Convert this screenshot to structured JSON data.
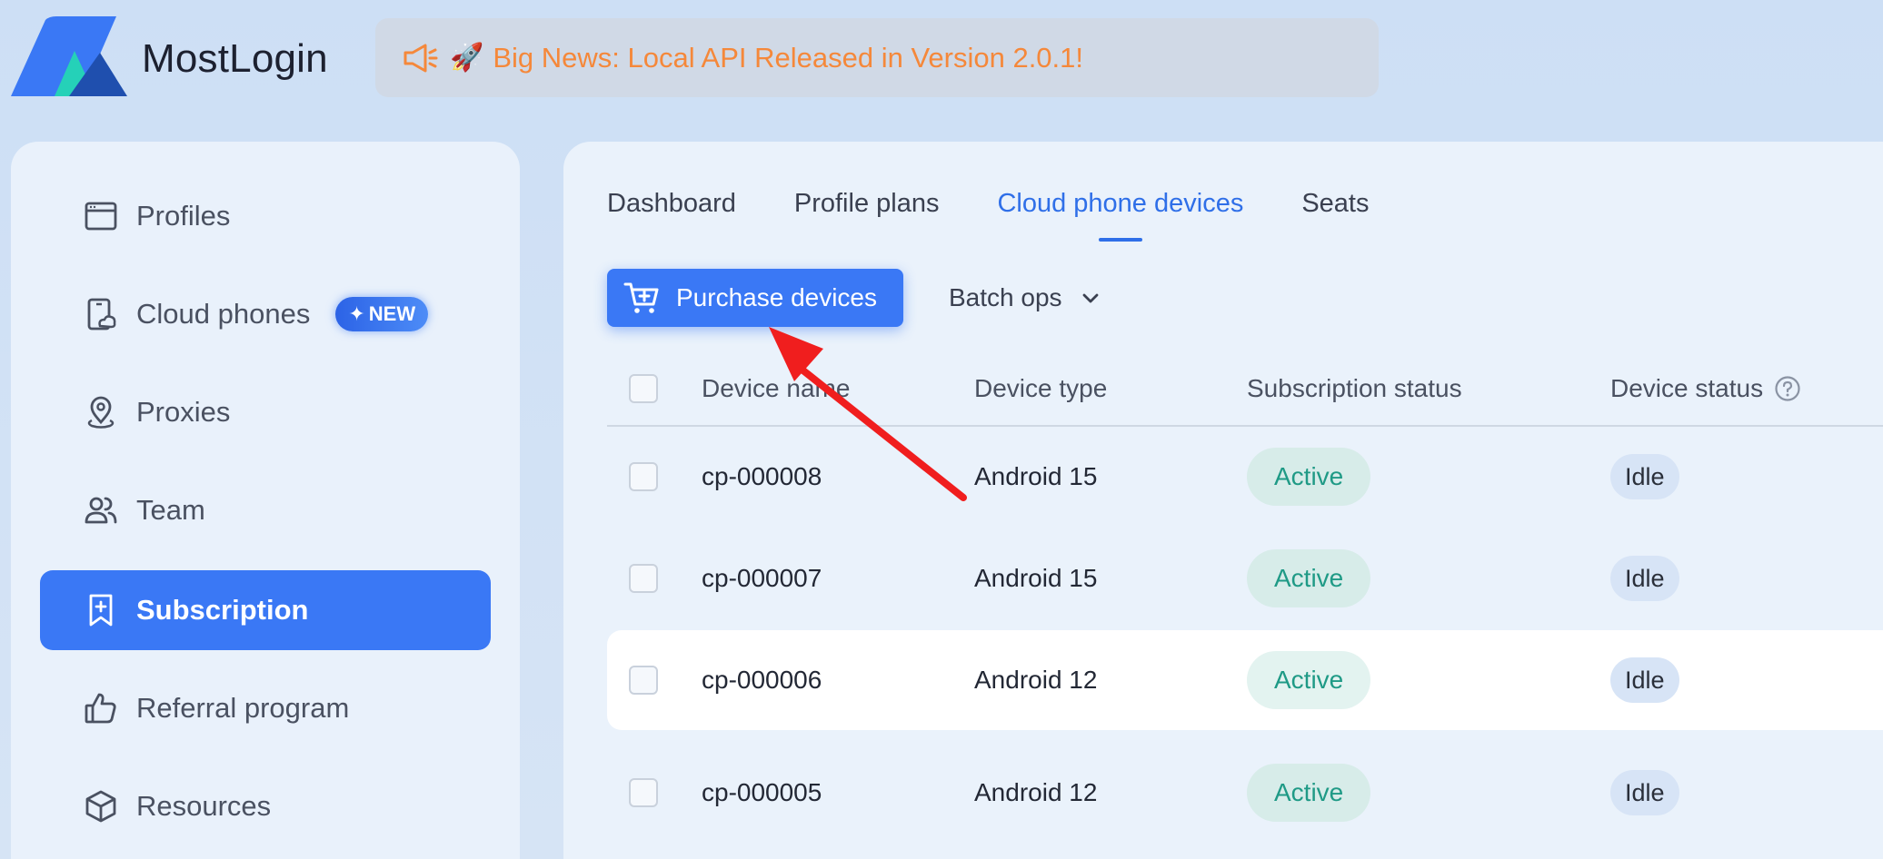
{
  "brand": {
    "name": "MostLogin"
  },
  "banner": {
    "text": "Big News: Local API Released in Version 2.0.1!",
    "rocket": "🚀"
  },
  "sidebar": {
    "items": [
      {
        "label": "Profiles",
        "icon": "browser-window-icon"
      },
      {
        "label": "Cloud phones",
        "icon": "cloud-phone-icon",
        "badge": "NEW"
      },
      {
        "label": "Proxies",
        "icon": "location-pin-icon"
      },
      {
        "label": "Team",
        "icon": "team-icon"
      },
      {
        "label": "Subscription",
        "icon": "bookmark-plus-icon",
        "active": true
      },
      {
        "label": "Referral program",
        "icon": "thumbs-up-icon"
      },
      {
        "label": "Resources",
        "icon": "cube-icon"
      }
    ]
  },
  "tabs": [
    {
      "label": "Dashboard"
    },
    {
      "label": "Profile plans"
    },
    {
      "label": "Cloud phone devices",
      "active": true
    },
    {
      "label": "Seats"
    }
  ],
  "toolbar": {
    "purchase_label": "Purchase devices",
    "batch_label": "Batch ops"
  },
  "table": {
    "headers": {
      "device_name": "Device name",
      "device_type": "Device type",
      "subscription_status": "Subscription status",
      "device_status": "Device status"
    },
    "rows": [
      {
        "device_name": "cp-000008",
        "device_type": "Android 15",
        "subscription_status": "Active",
        "device_status": "Idle"
      },
      {
        "device_name": "cp-000007",
        "device_type": "Android 15",
        "subscription_status": "Active",
        "device_status": "Idle"
      },
      {
        "device_name": "cp-000006",
        "device_type": "Android 12",
        "subscription_status": "Active",
        "device_status": "Idle"
      },
      {
        "device_name": "cp-000005",
        "device_type": "Android 12",
        "subscription_status": "Active",
        "device_status": "Idle"
      }
    ]
  },
  "colors": {
    "accent": "#3a78f5",
    "banner_text": "#f5883a",
    "active_status": "#1f9a86",
    "annotation_arrow": "#f01e1e"
  }
}
